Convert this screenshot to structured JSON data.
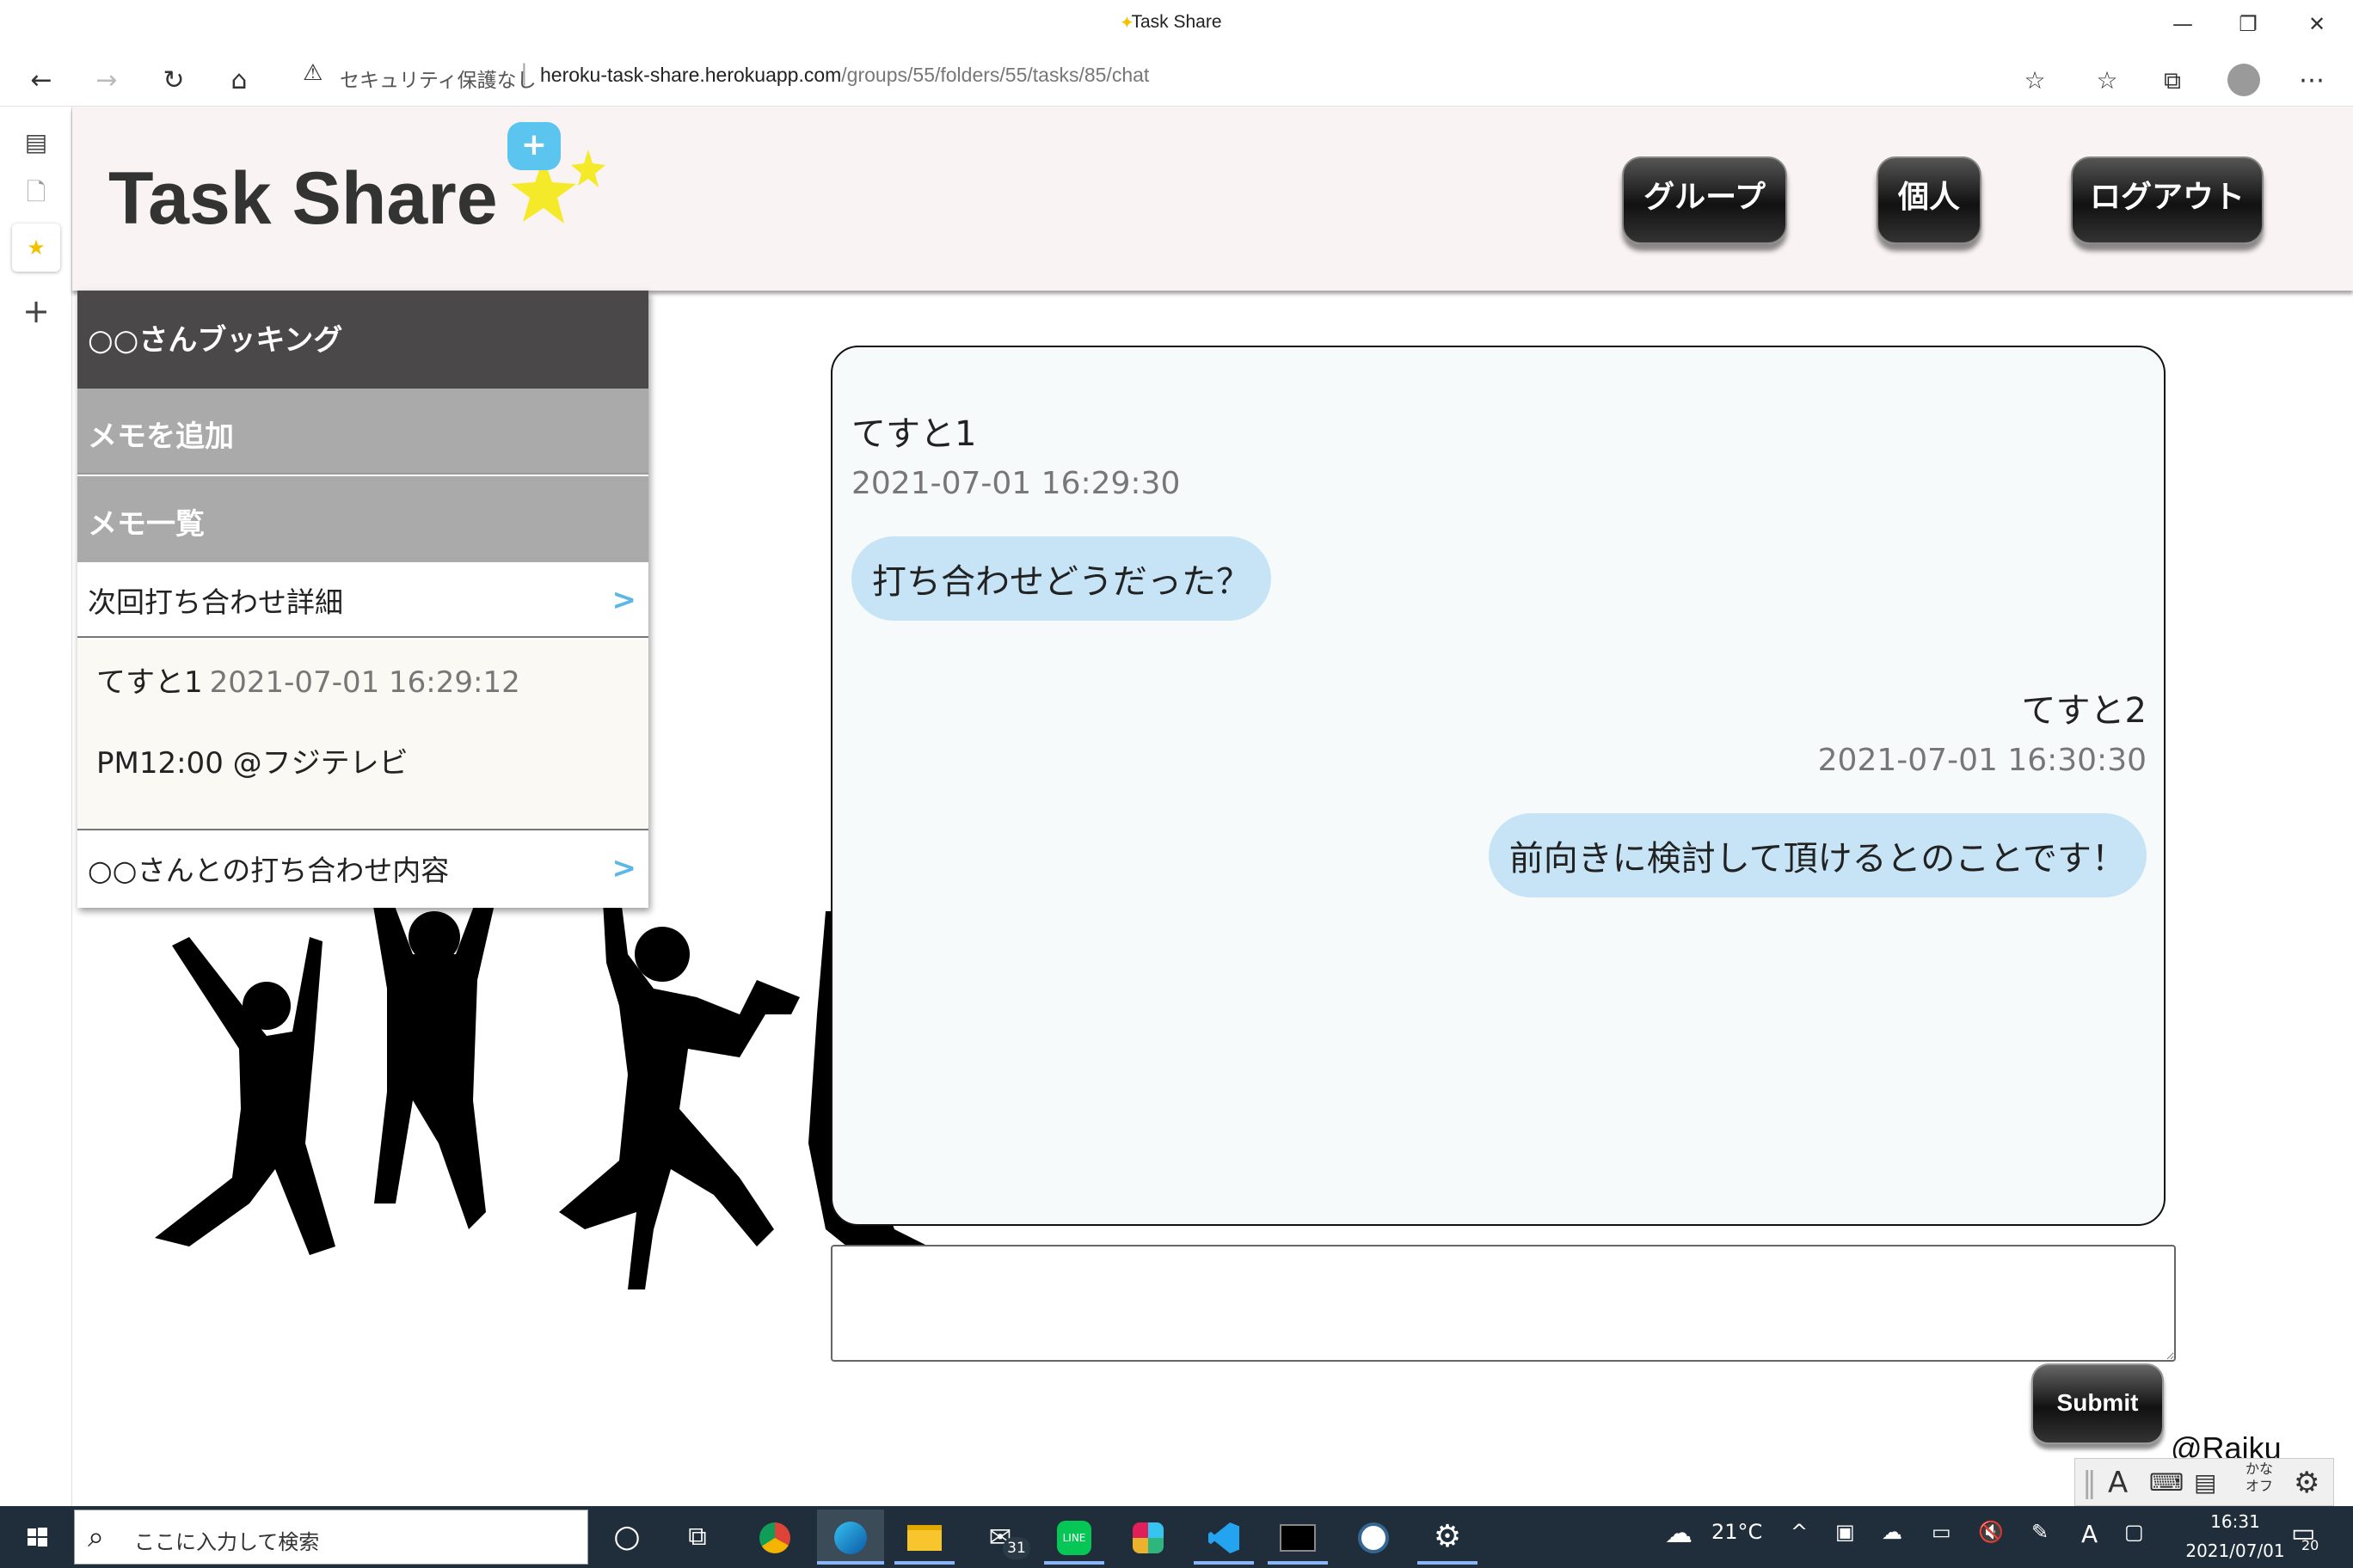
{
  "window": {
    "title": "Task Share",
    "minimize": "—",
    "restore": "❐",
    "close": "✕"
  },
  "browser": {
    "back": "←",
    "forward": "→",
    "refresh": "↻",
    "home": "⌂",
    "security_icon": "⚠",
    "security_label": "セキュリティ保護なし",
    "separator": "|",
    "url_host": "heroku-task-share.herokuapp.com",
    "url_path": "/groups/55/folders/55/tasks/85/chat",
    "add_favorite": "☆",
    "favorites": "☆",
    "collections": "⧉",
    "more": "⋯"
  },
  "rail": {
    "tabs_icon": "▤",
    "page_icon": "🗋",
    "active_tab_icon": "★",
    "new_tab": "+"
  },
  "header": {
    "title": "Task Share",
    "nav": [
      {
        "label": "グループ"
      },
      {
        "label": "個人"
      },
      {
        "label": "ログアウト"
      }
    ]
  },
  "memo": {
    "title": "○○さんブッキング",
    "add_label": "メモを追加",
    "add_button": "+",
    "list_header": "メモ一覧",
    "items": [
      {
        "label": "次回打ち合わせ詳細",
        "chevron": ">"
      },
      {
        "label": "○○さんとの打ち合わせ内容",
        "chevron": ">"
      }
    ],
    "detail": {
      "author": "てすと1",
      "time": "2021-07-01 16:29:12",
      "body": "PM12:00 @フジテレビ"
    }
  },
  "chat": {
    "messages": [
      {
        "author": "てすと1",
        "time": "2021-07-01 16:29:30",
        "text": "打ち合わせどうだった？",
        "side": "left"
      },
      {
        "author": "てすと2",
        "time": "2021-07-01 16:30:30",
        "text": "前向きに検討して頂けるとのことです！",
        "side": "right"
      }
    ],
    "input_value": "",
    "submit_label": "Submit"
  },
  "footer": {
    "credit": "@Raiku"
  },
  "ime": {
    "grip": "‖",
    "mode": "A",
    "kana_top": "かな",
    "kana_bottom": "オフ",
    "settings": "⚙"
  },
  "taskbar": {
    "search_placeholder": "ここに入力して検索",
    "search_icon": "⌕",
    "mail_badge": "31",
    "weather": "21°C",
    "clock_time": "16:31",
    "clock_date": "2021/07/01",
    "ime_indicator": "A",
    "notifications": "20"
  },
  "colors": {
    "header_bg": "#faf3f3",
    "memo_title_bg": "#4a4848",
    "memo_section_bg": "#aaaaaa",
    "accent_blue": "#5bc4ef",
    "bubble_bg": "#c6e4f6",
    "taskbar_bg": "#1f2e3a"
  }
}
